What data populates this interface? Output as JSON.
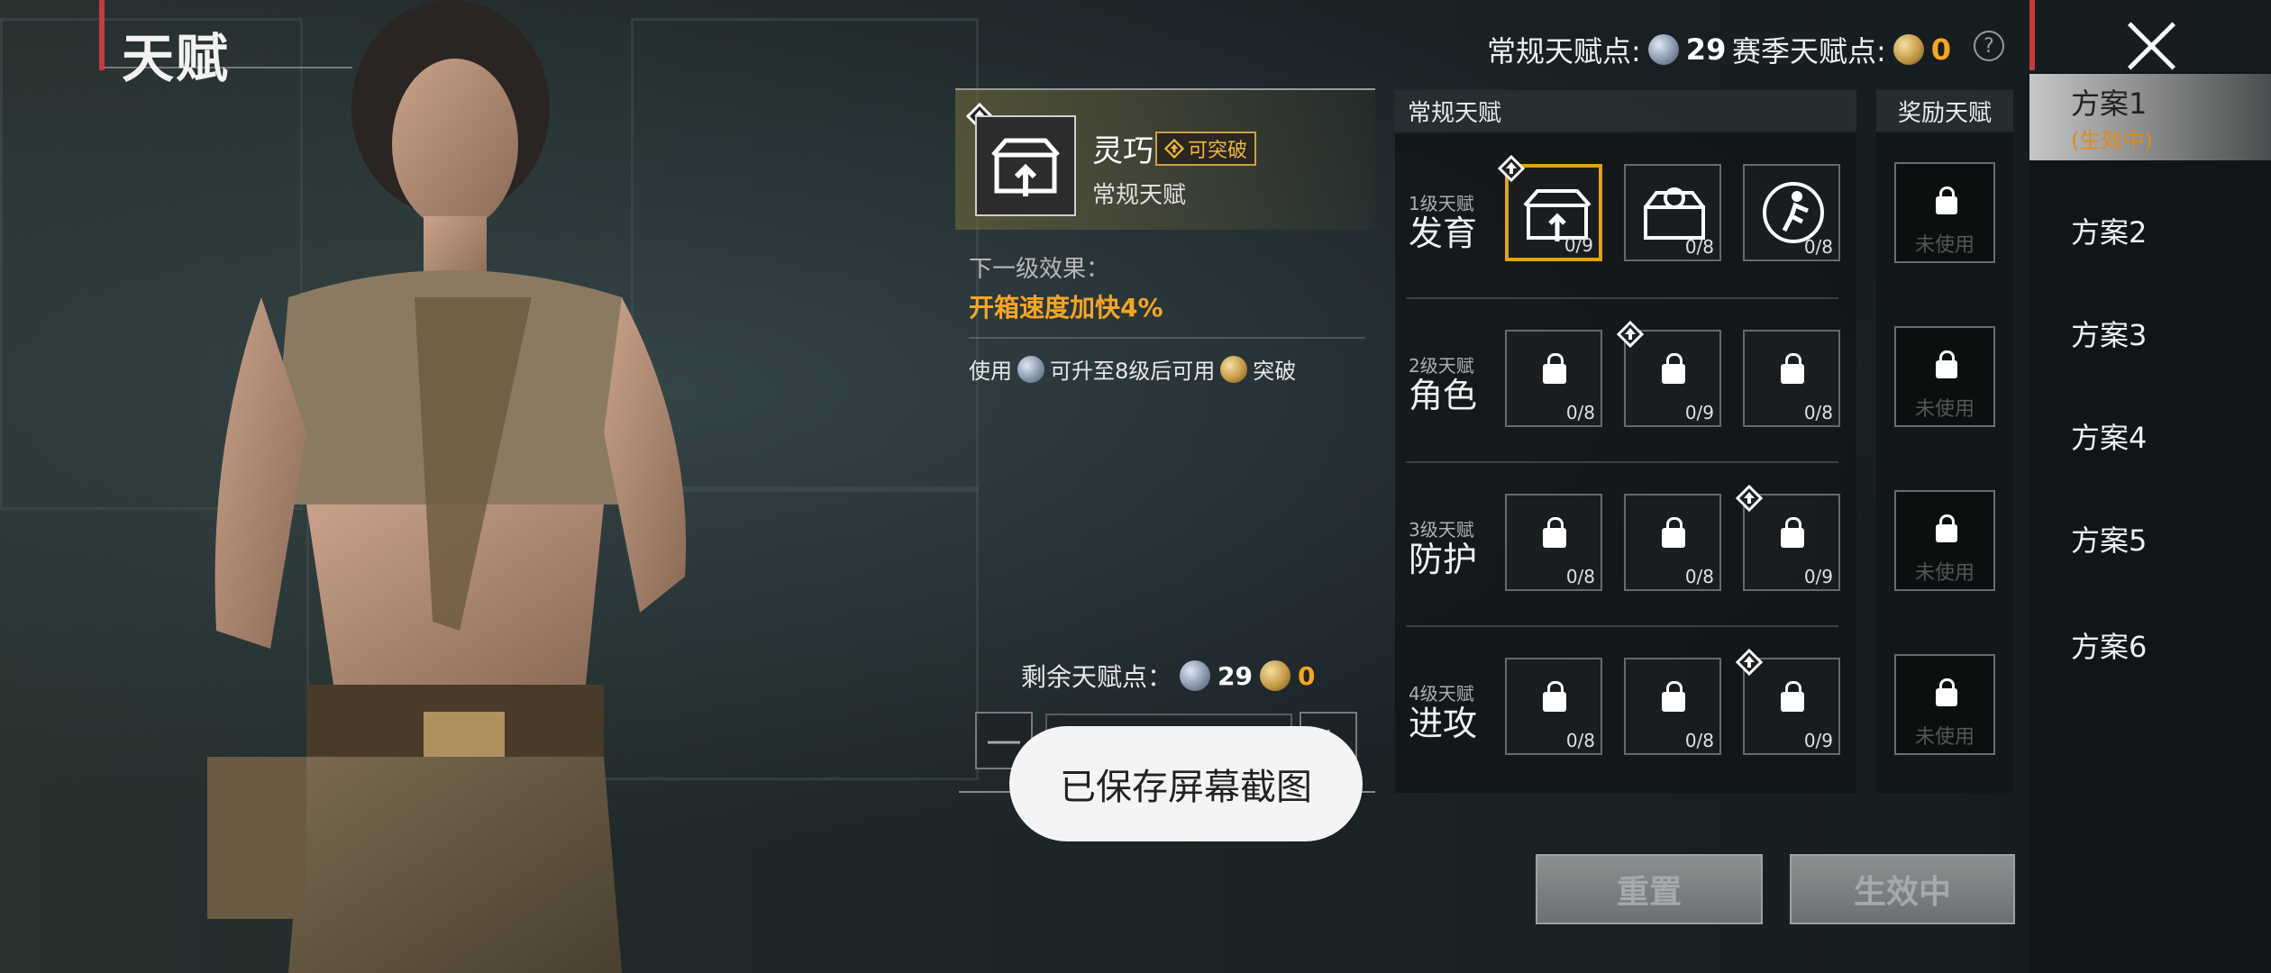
{
  "header": {
    "title": "天赋"
  },
  "points": {
    "regular_label": "常规天赋点:",
    "regular_value": "29",
    "season_label": "赛季天赋点:",
    "season_value": "0",
    "help_glyph": "?"
  },
  "schemes": [
    {
      "label": "方案1",
      "sub": "(生效中)",
      "active": true
    },
    {
      "label": "方案2"
    },
    {
      "label": "方案3"
    },
    {
      "label": "方案4"
    },
    {
      "label": "方案5"
    },
    {
      "label": "方案6"
    }
  ],
  "selected_talent": {
    "name": "灵巧",
    "badge": "可突破",
    "category": "常规天赋",
    "next_label": "下一级效果：",
    "next_effect": "开箱速度加快4%",
    "use_prefix": "使用",
    "use_middle": "可升至8级后可用",
    "use_suffix": "突破"
  },
  "remaining": {
    "label": "剩余天赋点：",
    "regular": "29",
    "season": "0"
  },
  "stepper": {
    "minus": "—",
    "plus": "+"
  },
  "toast": "已保存屏幕截图",
  "grid": {
    "regular_header": "常规天赋",
    "bonus_header": "奖励天赋",
    "rows": [
      {
        "level": "1级天赋",
        "name": "发育",
        "cells": [
          "0/9",
          "0/8",
          "0/8"
        ]
      },
      {
        "level": "2级天赋",
        "name": "角色",
        "cells": [
          "0/8",
          "0/9",
          "0/8"
        ]
      },
      {
        "level": "3级天赋",
        "name": "防护",
        "cells": [
          "0/8",
          "0/8",
          "0/9"
        ]
      },
      {
        "level": "4级天赋",
        "name": "进攻",
        "cells": [
          "0/8",
          "0/8",
          "0/9"
        ]
      }
    ],
    "bonus_cell_text": "未使用"
  },
  "buttons": {
    "reset": "重置",
    "apply": "生效中"
  },
  "colors": {
    "accent_orange": "#f5a623",
    "active_red": "#c43b3b",
    "selected_border": "#e0a020"
  }
}
